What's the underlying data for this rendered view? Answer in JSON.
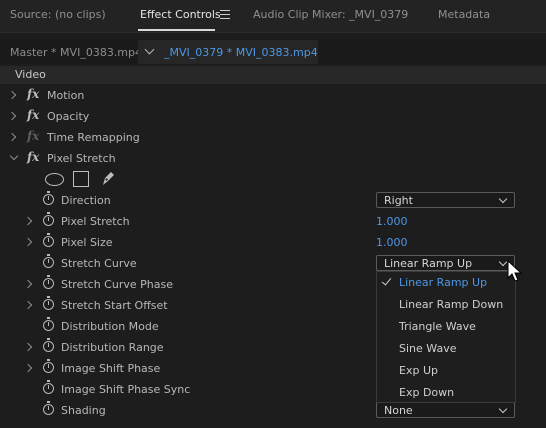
{
  "tabs": [
    {
      "label": "Source: (no clips)"
    },
    {
      "label": "Effect Controls"
    },
    {
      "label": "Audio Clip Mixer: _MVI_0379"
    },
    {
      "label": "Metadata"
    }
  ],
  "clip_header": {
    "master_label": "Master * MVI_0383.mp4",
    "clip_label": "_MVI_0379 * MVI_0383.mp4"
  },
  "video_header": "Video",
  "effects": {
    "motion": "Motion",
    "opacity": "Opacity",
    "time_remapping": "Time Remapping",
    "pixel_stretch": "Pixel Stretch"
  },
  "params": {
    "direction": {
      "label": "Direction",
      "value": "Right"
    },
    "pixel_stretch": {
      "label": "Pixel Stretch",
      "value": "1.000"
    },
    "pixel_size": {
      "label": "Pixel Size",
      "value": "1.000"
    },
    "stretch_curve": {
      "label": "Stretch Curve",
      "value": "Linear Ramp Up"
    },
    "stretch_curve_phase": {
      "label": "Stretch Curve Phase"
    },
    "stretch_start_offset": {
      "label": "Stretch Start Offset"
    },
    "distribution_mode": {
      "label": "Distribution Mode"
    },
    "distribution_range": {
      "label": "Distribution Range"
    },
    "image_shift_phase": {
      "label": "Image Shift Phase"
    },
    "image_shift_phase_sync": {
      "label": "Image Shift Phase Sync"
    },
    "shading": {
      "label": "Shading",
      "value": "None"
    }
  },
  "stretch_curve_menu": {
    "selected": "Linear Ramp Up",
    "options": [
      "Linear Ramp Up",
      "Linear Ramp Down",
      "Triangle Wave",
      "Sine Wave",
      "Exp Up",
      "Exp Down"
    ]
  },
  "colors": {
    "accent": "#4e97e6",
    "panel": "#1d1d1d"
  }
}
